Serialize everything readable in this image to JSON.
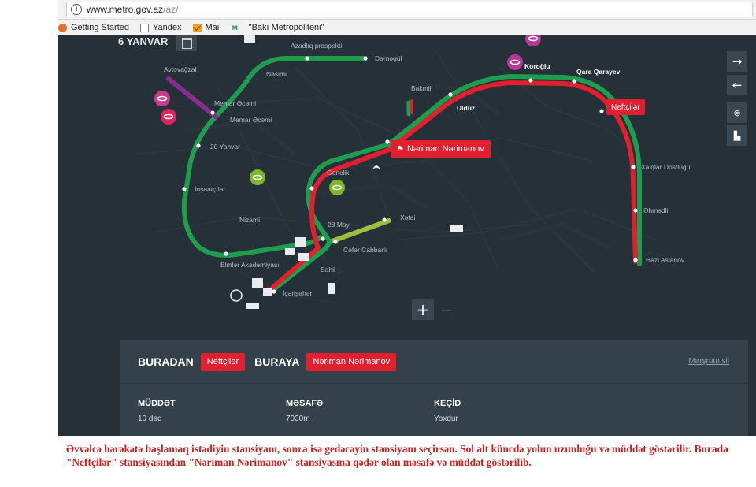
{
  "browser": {
    "url_host": "www.metro.gov.az",
    "url_path": "/az/",
    "bookmarks": [
      "Getting Started",
      "Yandex",
      "Mail",
      "\"Bakı Metropoliteni\""
    ]
  },
  "map": {
    "date_label": "6 YANVAR",
    "stations": {
      "azadliq": "Azadlıq prospekti",
      "daragul": "Dərnəgül",
      "nasimi": "Nəsimi",
      "avtovagzal": "Avtovağzal",
      "memar1": "Memar Əcəmi",
      "memar2": "Memar Əcəmi",
      "yanvar20": "20 Yanvar",
      "insaatcilar": "İnşaatçılar",
      "nizami": "Nizami",
      "elmler": "Elmlər Akademiyası",
      "bakmil": "Bakmil",
      "ulduz": "Ulduz",
      "koroglu": "Koroğlu",
      "qara": "Qara Qarayev",
      "neftciler": "Neftçilər",
      "xalqlar": "Xalqlar Dostluğu",
      "ahmadli": "Əhmədli",
      "hazi": "Həzi Aslanov",
      "genclik": "Gənclik",
      "may28": "28 May",
      "xatai": "Xətai",
      "cafar": "Cəfər Cabbarlı",
      "sahil": "Sahil",
      "icarisahar": "İçərişəhər"
    },
    "pin_from": "Neftçilər",
    "pin_to": "Nəriman Nərimanov",
    "zoom_in": "+",
    "zoom_out": "−",
    "controls": [
      "→",
      "←"
    ]
  },
  "route": {
    "from_key": "BURADAN",
    "from_value": "Neftçilər",
    "to_key": "BURAYA",
    "to_value": "Nəriman Nərimanov",
    "clear_link": "Marşrutu sil",
    "duration_key": "MÜDDƏT",
    "duration_value": "10 dəq",
    "distance_key": "MƏSAFƏ",
    "distance_value": "7030m",
    "transfer_key": "KEÇİD",
    "transfer_value": "Yoxdur"
  },
  "caption": "Əvvəlcə hərəkətə başlamaq istədiyin stansiyanı, sonra isə gedəcəyin stansiyanı seçirsən. Sol alt küncdə yolun uzunluğu və müddət göstərilir. Burada \"Neftçilər\" stansiyasından \"Nəriman Nərimanov\" stansiyasına qədər olan məsafə və müddət göstərilib.",
  "colors": {
    "map_bg": "#253038",
    "green_line": "#1f9d4f",
    "red_line": "#e0202e",
    "purple_line": "#8a2c8f",
    "light_green_line": "#9ac23c",
    "caption": "#cc1f1f"
  }
}
